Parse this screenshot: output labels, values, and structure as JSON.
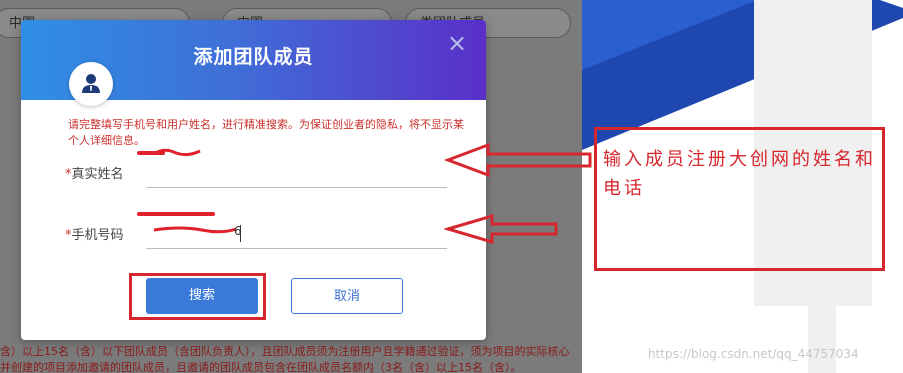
{
  "background": {
    "pill_1": "中国",
    "pill_2": "中国",
    "pill_3": "类团队成员",
    "bottom_line_1": "含）以上15名（含）以下团队成员（含团队负责人），且团队成员须为注册用户且学籍通过验证，须为项目的实际核心",
    "bottom_line_2": "并创建的项目添加邀请的团队成员，且邀请的团队成员包含在团队成员名额内（3名（含）以上15名（含）。"
  },
  "modal": {
    "title": "添加团队成员",
    "close_symbol": "×",
    "notice": "请完整填写手机号和用户姓名，进行精准搜索。为保证创业者的隐私，将不显示某个人详细信息。",
    "name_field": {
      "required_mark": "*",
      "label": "真实姓名"
    },
    "phone_field": {
      "required_mark": "*",
      "label": "手机号码",
      "value_tail": "6"
    },
    "search_label": "搜索",
    "cancel_label": "取消"
  },
  "annotation": {
    "caption": "输入成员注册大创网的姓名和电话",
    "color": "#d6262e"
  },
  "watermark": "https://blog.csdn.net/qq_44757034",
  "colors": {
    "header_start": "#2f8fe6",
    "header_end": "#5a2fc8",
    "primary": "#3b7ad8",
    "notice": "#c9302c"
  },
  "icons": {
    "avatar": "user-icon",
    "close": "close-icon",
    "arrows": "left-arrow-icon"
  }
}
